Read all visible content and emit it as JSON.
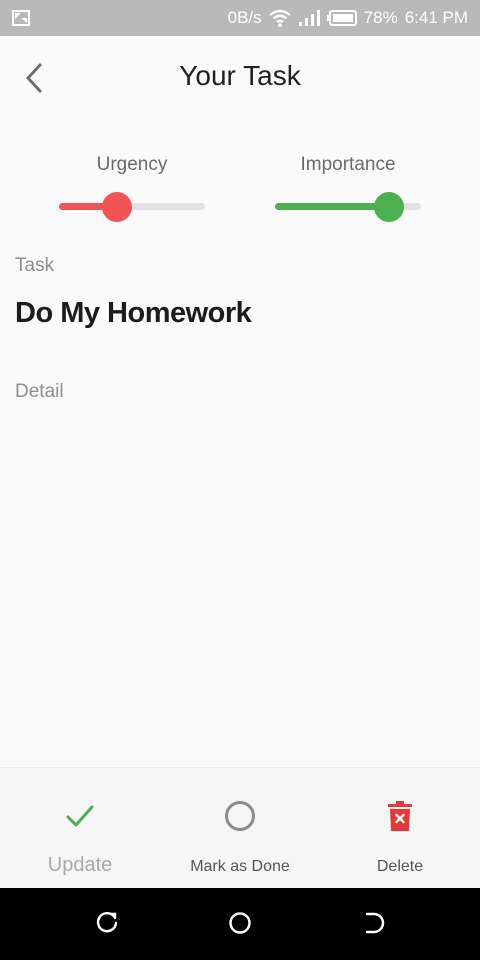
{
  "status_bar": {
    "data_rate": "0B/s",
    "battery": "78%",
    "time": "6:41 PM",
    "icons": [
      "screenshot-icon",
      "wifi-icon",
      "signal-icon",
      "battery-icon"
    ]
  },
  "header": {
    "title": "Your Task",
    "back_icon": "chevron-left-icon"
  },
  "urgency": {
    "label": "Urgency",
    "level": 0.4,
    "color": "#f05454"
  },
  "importance": {
    "label": "Importance",
    "level": 0.78,
    "color": "#4caf50"
  },
  "task": {
    "label": "Task",
    "value": "Do My Homework"
  },
  "detail": {
    "label": "Detail",
    "value": ""
  },
  "actions": {
    "update": {
      "label": "Update",
      "icon": "check-icon",
      "color": "#4caf50"
    },
    "mark_done": {
      "label": "Mark as Done",
      "icon": "circle-icon"
    },
    "delete": {
      "label": "Delete",
      "icon": "trash-icon",
      "color": "#e53935"
    }
  },
  "nav_bar": {
    "icons": [
      "recent-apps-icon",
      "home-icon",
      "back-icon"
    ]
  }
}
